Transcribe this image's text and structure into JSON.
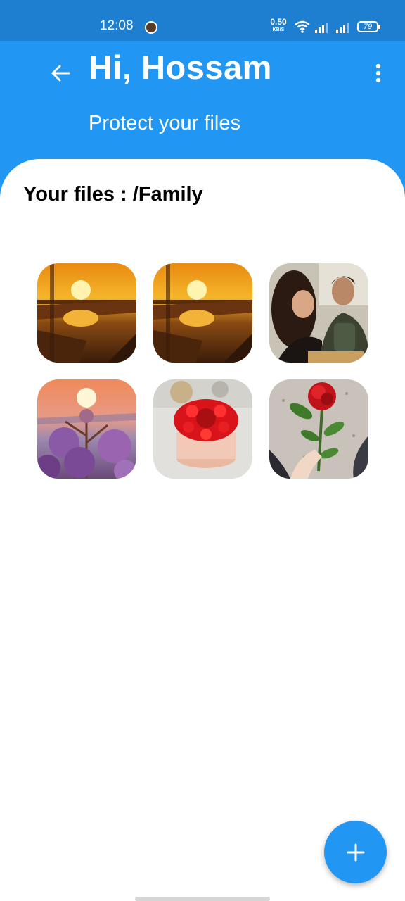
{
  "status_bar": {
    "time": "12:08",
    "net_speed_value": "0.50",
    "net_speed_unit": "KB/S",
    "battery": "79",
    "icons": [
      "notification-avatar-icon",
      "wifi-icon",
      "signal-icon",
      "signal-icon",
      "battery-icon"
    ]
  },
  "header": {
    "greeting": "Hi, Hossam",
    "subtitle": "Protect your files",
    "back_icon": "arrow-back-icon",
    "menu_icon": "more-vert-icon"
  },
  "files": {
    "title": "Your files : /Family",
    "items": [
      {
        "kind": "sunset-bridge"
      },
      {
        "kind": "sunset-bridge"
      },
      {
        "kind": "couple"
      },
      {
        "kind": "sunset-flowers"
      },
      {
        "kind": "cake"
      },
      {
        "kind": "rose"
      }
    ]
  },
  "fab": {
    "icon": "plus-icon"
  },
  "colors": {
    "primary": "#2196F3",
    "status_bar": "#1E7FD0",
    "card": "#FFFFFF"
  }
}
